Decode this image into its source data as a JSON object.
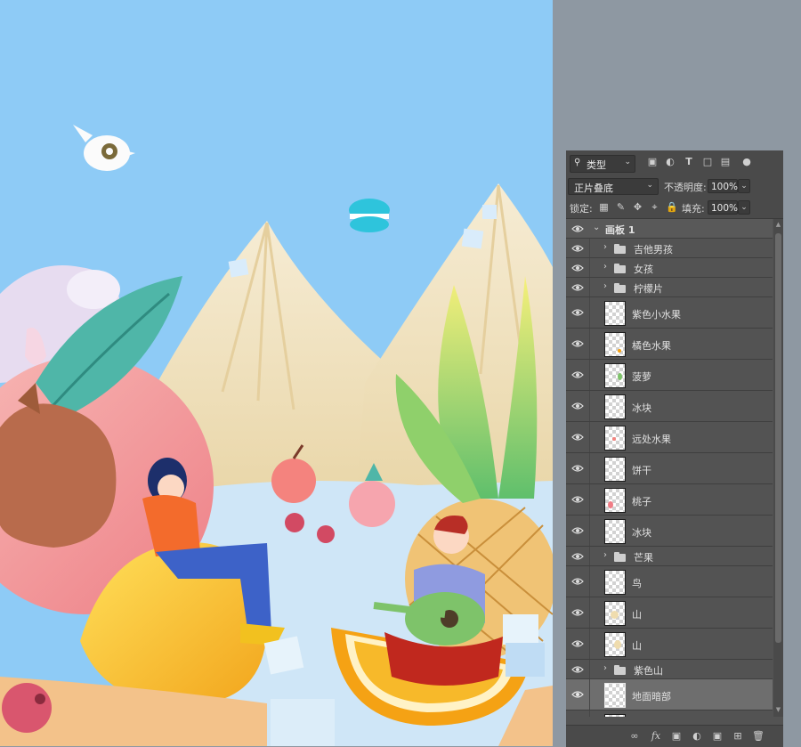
{
  "layers_panel": {
    "filter": {
      "label": "类型",
      "icon": "search-icon"
    },
    "blend_mode": "正片叠底",
    "opacity_label": "不透明度:",
    "opacity_value": "100%",
    "lock_label": "锁定:",
    "fill_label": "填充:",
    "fill_value": "100%",
    "artboard_name": "画板 1",
    "layers": [
      {
        "name": "吉他男孩",
        "type": "group"
      },
      {
        "name": "女孩",
        "type": "group"
      },
      {
        "name": "柠檬片",
        "type": "group"
      },
      {
        "name": "紫色小水果",
        "type": "layer"
      },
      {
        "name": "橘色水果",
        "type": "layer"
      },
      {
        "name": "菠萝",
        "type": "layer"
      },
      {
        "name": "冰块",
        "type": "layer"
      },
      {
        "name": "远处水果",
        "type": "layer"
      },
      {
        "name": "饼干",
        "type": "layer"
      },
      {
        "name": "桃子",
        "type": "layer"
      },
      {
        "name": "冰块",
        "type": "layer"
      },
      {
        "name": "芒果",
        "type": "group"
      },
      {
        "name": "鸟",
        "type": "layer"
      },
      {
        "name": "山",
        "type": "layer"
      },
      {
        "name": "山",
        "type": "layer"
      },
      {
        "name": "紫色山",
        "type": "group"
      },
      {
        "name": "地面暗部",
        "type": "layer",
        "selected": true
      }
    ],
    "bottom_icons": [
      "link-icon",
      "fx-icon",
      "mask-icon",
      "adjustment-icon",
      "folder-icon",
      "new-layer-icon",
      "trash-icon"
    ]
  },
  "colors": {
    "sky": "#8ecbf6",
    "panel_bg": "#535353",
    "workspace_bg": "#8e98a2",
    "selected_row": "#6e6e6e"
  }
}
